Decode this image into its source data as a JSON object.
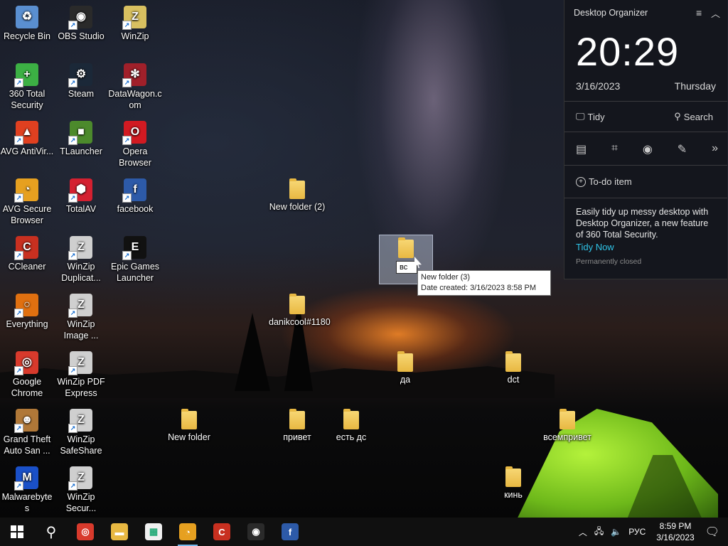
{
  "desktop": {
    "icons": [
      {
        "label": "Recycle Bin",
        "icon": "recycle-bin-icon",
        "color": "#5a8fd0",
        "glyph": "♻"
      },
      {
        "label": "OBS Studio",
        "icon": "obs-icon",
        "color": "#2a2a2a",
        "glyph": "◉"
      },
      {
        "label": "WinZip",
        "icon": "winzip-icon",
        "color": "#d8c060",
        "glyph": "Z"
      },
      {
        "label": "360 Total Security",
        "icon": "360-security-icon",
        "color": "#3cb044",
        "glyph": "+"
      },
      {
        "label": "Steam",
        "icon": "steam-icon",
        "color": "#1b2838",
        "glyph": "⚙"
      },
      {
        "label": "DataWagon.com",
        "icon": "datawagon-icon",
        "color": "#a0202a",
        "glyph": "✻"
      },
      {
        "label": "AVG AntiVir...",
        "icon": "avg-antivirus-icon",
        "color": "#e04020",
        "glyph": "▲"
      },
      {
        "label": "TLauncher",
        "icon": "tlauncher-icon",
        "color": "#4c8a2c",
        "glyph": "■"
      },
      {
        "label": "Opera Browser",
        "icon": "opera-icon",
        "color": "#d11a22",
        "glyph": "O"
      },
      {
        "label": "AVG Secure Browser",
        "icon": "avg-secure-browser-icon",
        "color": "#e6a020",
        "glyph": "◔"
      },
      {
        "label": "TotalAV",
        "icon": "totalav-icon",
        "color": "#d42030",
        "glyph": "⬢"
      },
      {
        "label": "facebook",
        "icon": "facebook-icon",
        "color": "#2d5aa8",
        "glyph": "f"
      },
      {
        "label": "CCleaner",
        "icon": "ccleaner-icon",
        "color": "#c83020",
        "glyph": "C"
      },
      {
        "label": "WinZip Duplicat...",
        "icon": "winzip-duplicate-icon",
        "color": "#cfcfcf",
        "glyph": "Z"
      },
      {
        "label": "Epic Games Launcher",
        "icon": "epic-games-icon",
        "color": "#111111",
        "glyph": "E"
      },
      {
        "label": "Everything",
        "icon": "everything-icon",
        "color": "#e07010",
        "glyph": "○"
      },
      {
        "label": "WinZip Image ...",
        "icon": "winzip-image-icon",
        "color": "#cfcfcf",
        "glyph": "Z"
      },
      {
        "label": "Google Chrome",
        "icon": "chrome-icon",
        "color": "#d83a2c",
        "glyph": "◎"
      },
      {
        "label": "WinZip PDF Express",
        "icon": "winzip-pdf-icon",
        "color": "#cfcfcf",
        "glyph": "Z"
      },
      {
        "label": "Grand Theft Auto San ...",
        "icon": "gta-icon",
        "color": "#b07838",
        "glyph": "☻"
      },
      {
        "label": "WinZip SafeShare",
        "icon": "winzip-safeshare-icon",
        "color": "#cfcfcf",
        "glyph": "Z"
      },
      {
        "label": "Malwarebytes",
        "icon": "malwarebytes-icon",
        "color": "#1a50c8",
        "glyph": "M"
      },
      {
        "label": "WinZip Secur...",
        "icon": "winzip-secure-icon",
        "color": "#cfcfcf",
        "glyph": "Z"
      }
    ],
    "folders": [
      {
        "label": "New folder (2)"
      },
      {
        "label": "danikcool#1180"
      },
      {
        "label": "да"
      },
      {
        "label": "dct"
      },
      {
        "label": "New folder"
      },
      {
        "label": "привет"
      },
      {
        "label": "есть дс"
      },
      {
        "label": "всемпривет"
      },
      {
        "label": "кинь"
      }
    ],
    "rename_value": "вс",
    "tooltip_line1": "New folder (3)",
    "tooltip_line2": "Date created: 3/16/2023 8:58 PM"
  },
  "organizer": {
    "title": "Desktop Organizer",
    "time": "20:29",
    "date": "3/16/2023",
    "day": "Thursday",
    "tidy_label": "Tidy",
    "search_label": "Search",
    "todo_label": "To-do item",
    "promo_text": "Easily tidy up messy desktop with Desktop Organizer, a new feature of 360 Total Security.",
    "link_label": "Tidy Now",
    "closed_label": "Permanently closed"
  },
  "taskbar": {
    "apps": [
      {
        "icon": "chrome-icon",
        "color": "#d83a2c",
        "glyph": "◎"
      },
      {
        "icon": "file-explorer-icon",
        "color": "#e8b842",
        "glyph": "▬"
      },
      {
        "icon": "microsoft-store-icon",
        "color": "#f0f0f0",
        "glyph": "▦"
      },
      {
        "icon": "avg-secure-browser-icon",
        "color": "#e6a020",
        "glyph": "◔"
      },
      {
        "icon": "ccleaner-icon",
        "color": "#c83020",
        "glyph": "C"
      },
      {
        "icon": "obs-icon",
        "color": "#2a2a2a",
        "glyph": "◉"
      },
      {
        "icon": "facebook-icon",
        "color": "#2d5aa8",
        "glyph": "f"
      }
    ],
    "language": "РУС",
    "clock_time": "8:59 PM",
    "clock_date": "3/16/2023"
  }
}
